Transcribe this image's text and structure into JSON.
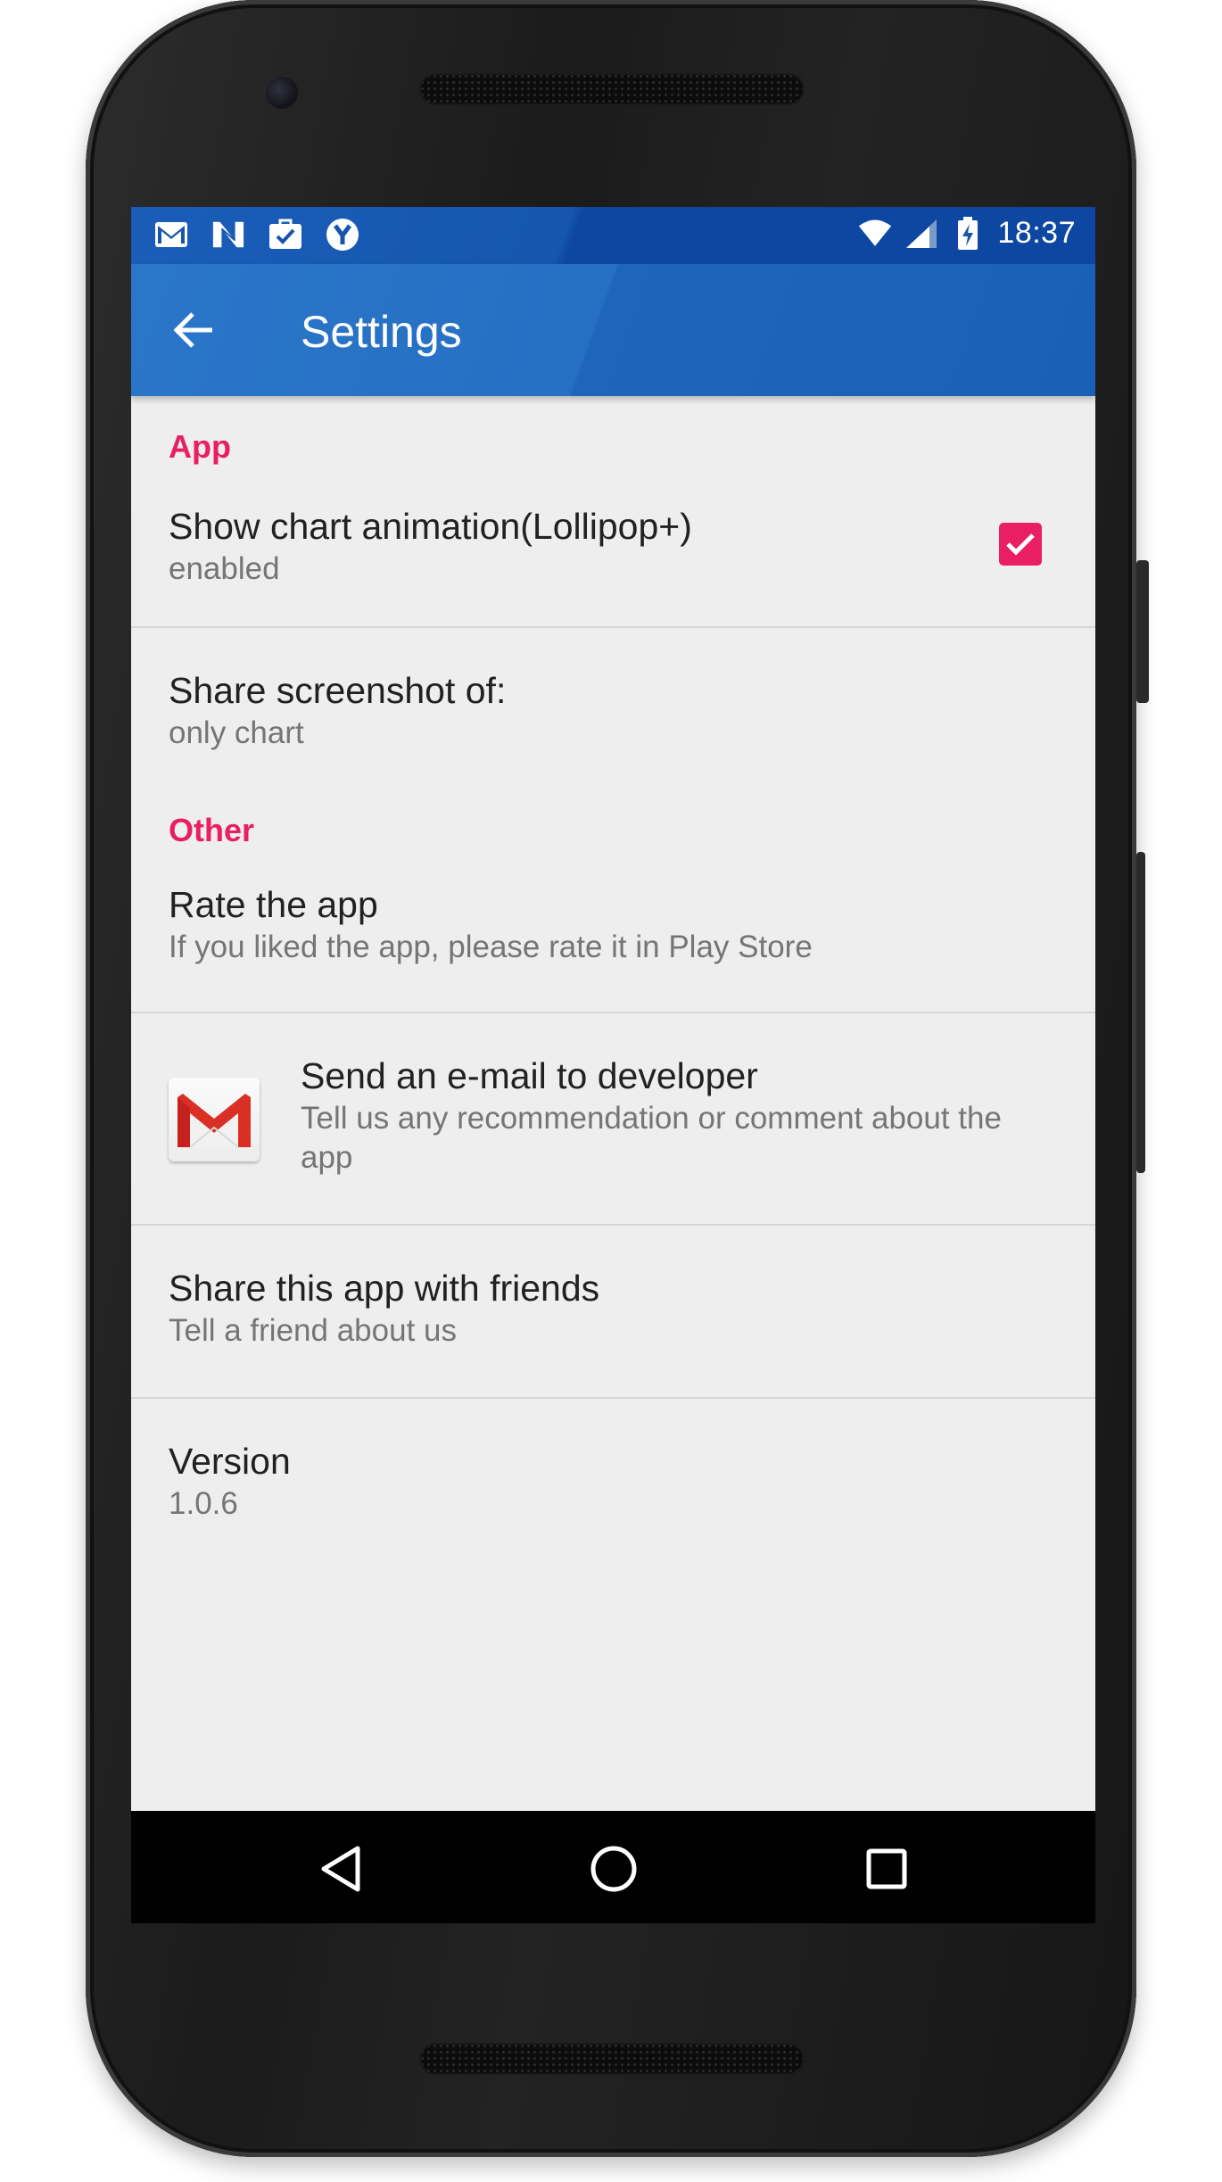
{
  "status_bar": {
    "left_icons": [
      "gmail-icon",
      "n-icon",
      "briefcase-check-icon",
      "y-icon"
    ],
    "right_icons": [
      "wifi-icon",
      "signal-icon",
      "battery-charging-icon"
    ],
    "time": "18:37"
  },
  "app_bar": {
    "back_icon": "arrow-left-icon",
    "title": "Settings"
  },
  "sections": {
    "app": {
      "header": "App",
      "chart_animation": {
        "title": "Show chart animation(Lollipop+)",
        "summary": "enabled",
        "checked": true
      },
      "share_screenshot": {
        "title": "Share screenshot of:",
        "summary": "only chart"
      }
    },
    "other": {
      "header": "Other",
      "rate": {
        "title": "Rate the app",
        "summary": "If you liked the app, please rate it in Play Store"
      },
      "email": {
        "title": "Send an e-mail to developer",
        "summary_line1": "Tell us any recommendation or comment about the",
        "summary_line2": "app",
        "icon": "gmail-icon"
      },
      "share_app": {
        "title": "Share this app with friends",
        "summary": "Tell a friend about us"
      },
      "version": {
        "title": "Version",
        "summary": "1.0.6"
      }
    }
  },
  "nav_bar": {
    "icons": [
      "back-triangle-icon",
      "home-circle-icon",
      "recents-square-icon"
    ]
  },
  "colors": {
    "primary": "#1a5fb8",
    "status_bar": "#0d47a1",
    "accent": "#e91e63",
    "background": "#eeeeee"
  }
}
